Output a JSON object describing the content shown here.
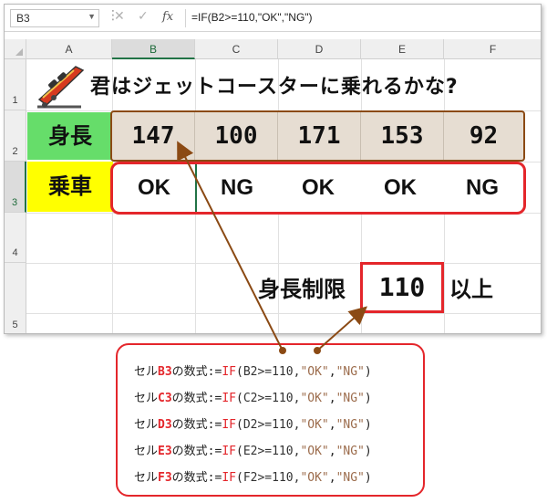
{
  "formula_bar": {
    "name_box": "B3",
    "formula": "=IF(B2>=110,\"OK\",\"NG\")"
  },
  "columns": [
    "A",
    "B",
    "C",
    "D",
    "E",
    "F"
  ],
  "rows": [
    "1",
    "2",
    "3",
    "4",
    "5"
  ],
  "title": "君はジェットコースターに乗れるかな?",
  "height_label": "身長",
  "ride_label": "乗車",
  "heights": [
    "147",
    "100",
    "171",
    "153",
    "92"
  ],
  "results": [
    "OK",
    "NG",
    "OK",
    "OK",
    "NG"
  ],
  "limit": {
    "label": "身長制限",
    "value": "110",
    "suffix": "以上"
  },
  "note": {
    "lines": [
      {
        "prefix": "セル",
        "cell": "B3",
        "mid": "の数式:",
        "eq": "=",
        "fn": "IF",
        "open": "(",
        "ref": "B2>=110,",
        "ok": "\"OK\"",
        "comma": ",",
        "ng": "\"NG\"",
        "close": ")"
      },
      {
        "prefix": "セル",
        "cell": "C3",
        "mid": "の数式:",
        "eq": "=",
        "fn": "IF",
        "open": "(",
        "ref": "C2>=110,",
        "ok": "\"OK\"",
        "comma": ",",
        "ng": "\"NG\"",
        "close": ")"
      },
      {
        "prefix": "セル",
        "cell": "D3",
        "mid": "の数式:",
        "eq": "=",
        "fn": "IF",
        "open": "(",
        "ref": "D2>=110,",
        "ok": "\"OK\"",
        "comma": ",",
        "ng": "\"NG\"",
        "close": ")"
      },
      {
        "prefix": "セル",
        "cell": "E3",
        "mid": "の数式:",
        "eq": "=",
        "fn": "IF",
        "open": "(",
        "ref": "E2>=110,",
        "ok": "\"OK\"",
        "comma": ",",
        "ng": "\"NG\"",
        "close": ")"
      },
      {
        "prefix": "セル",
        "cell": "F3",
        "mid": "の数式:",
        "eq": "=",
        "fn": "IF",
        "open": "(",
        "ref": "F2>=110,",
        "ok": "\"OK\"",
        "comma": ",",
        "ng": "\"NG\"",
        "close": ")"
      }
    ]
  },
  "colors": {
    "height_label_bg": "#66dd6a",
    "ride_label_bg": "#ffff00",
    "accent_red": "#e4262b",
    "arrow_brown": "#8b4a14"
  }
}
